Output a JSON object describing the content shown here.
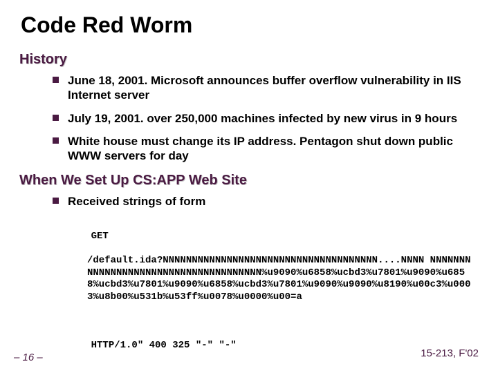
{
  "title": "Code Red Worm",
  "sections": [
    {
      "heading": "History",
      "bullets": [
        "June 18, 2001.  Microsoft announces buffer overflow vulnerability in IIS Internet server",
        "July 19, 2001. over 250,000 machines infected by new virus in 9 hours",
        "White house must change its IP address.  Pentagon shut down public WWW servers for day"
      ]
    },
    {
      "heading": "When We Set Up CS:APP Web Site",
      "bullets": [
        "Received strings of form"
      ]
    }
  ],
  "code": {
    "line1": "GET",
    "body": "/default.ida?NNNNNNNNNNNNNNNNNNNNNNNNNNNNNNNNNNNNN....NNNN NNNNNNNNNNNNNNNNNNNNNNNNNNNNNNNNNNNNN%u9090%u6858%ucbd3%u7801%u9090%u6858%ucbd3%u7801%u9090%u6858%ucbd3%u7801%u9090%u9090%u8190%u00c3%u0003%u8b00%u531b%u53ff%u0078%u0000%u00=a",
    "line2": "HTTP/1.0\" 400 325 \"-\" \"-\""
  },
  "footer": {
    "left": "– 16 –",
    "right": "15-213, F'02"
  }
}
